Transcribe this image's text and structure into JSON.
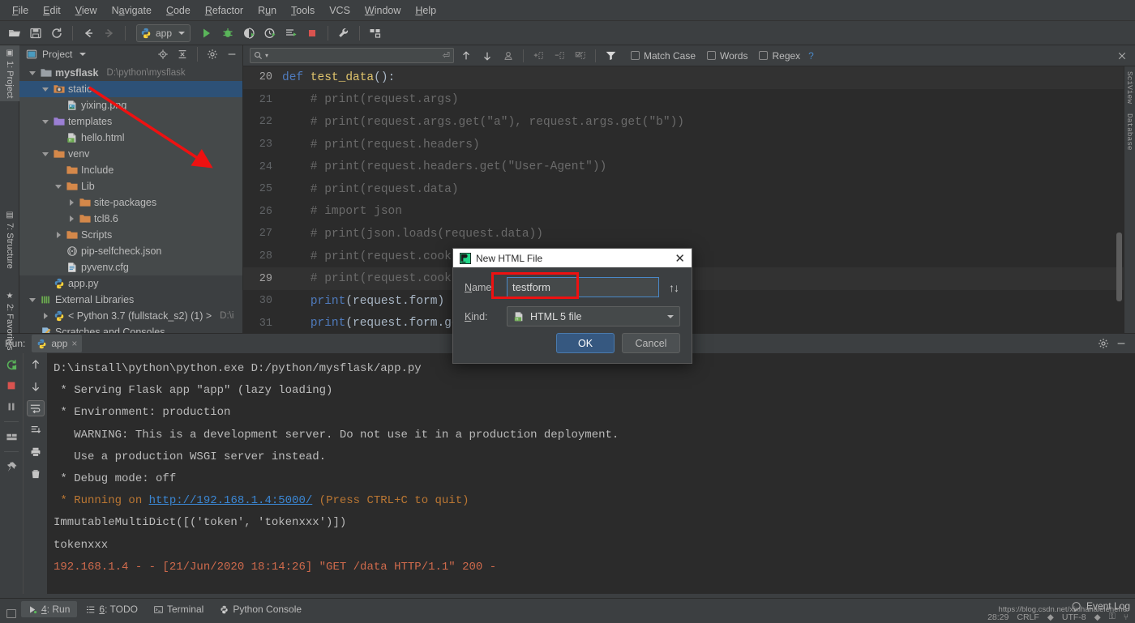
{
  "menubar": {
    "items": [
      "File",
      "Edit",
      "View",
      "Navigate",
      "Code",
      "Refactor",
      "Run",
      "Tools",
      "VCS",
      "Window",
      "Help"
    ]
  },
  "toolbar": {
    "run_config": "app",
    "icons": [
      "open-folder-icon",
      "save-icon",
      "sync-icon",
      "back-arrow-icon",
      "forward-arrow-icon",
      "run-icon",
      "debug-icon",
      "coverage-icon",
      "profile-icon",
      "run-with-console-icon",
      "stop-icon",
      "settings-wrench-icon",
      "structure-icon"
    ]
  },
  "left_strip": {
    "tabs": [
      {
        "label": "1: Project",
        "selected": true
      },
      {
        "label": "7: Structure",
        "selected": false
      },
      {
        "label": "2: Favorites",
        "selected": false
      }
    ]
  },
  "project_panel": {
    "title": "Project",
    "header_icons": [
      "locate-icon",
      "collapse-all-icon",
      "gear-icon",
      "minimize-icon"
    ],
    "tree": [
      {
        "label": "mysflask",
        "path": "D:\\python\\mysflask",
        "depth": 0,
        "twisty": "open",
        "icon": "folder-grey",
        "bold": true,
        "state": "normal"
      },
      {
        "label": "static",
        "path": "",
        "depth": 1,
        "twisty": "open",
        "icon": "folder-static",
        "bold": false,
        "state": "selected"
      },
      {
        "label": "yixing.png",
        "path": "",
        "depth": 2,
        "twisty": "none",
        "icon": "image-file",
        "bold": false,
        "state": "highlight"
      },
      {
        "label": "templates",
        "path": "",
        "depth": 1,
        "twisty": "open",
        "icon": "folder-purple",
        "bold": false,
        "state": "highlight"
      },
      {
        "label": "hello.html",
        "path": "",
        "depth": 2,
        "twisty": "none",
        "icon": "html-file",
        "bold": false,
        "state": "highlight"
      },
      {
        "label": "venv",
        "path": "",
        "depth": 1,
        "twisty": "open",
        "icon": "folder-orange",
        "bold": false,
        "state": "highlight"
      },
      {
        "label": "Include",
        "path": "",
        "depth": 2,
        "twisty": "none",
        "icon": "folder-orange",
        "bold": false,
        "state": "highlight"
      },
      {
        "label": "Lib",
        "path": "",
        "depth": 2,
        "twisty": "open",
        "icon": "folder-orange",
        "bold": false,
        "state": "highlight"
      },
      {
        "label": "site-packages",
        "path": "",
        "depth": 3,
        "twisty": "closed",
        "icon": "folder-orange",
        "bold": false,
        "state": "highlight"
      },
      {
        "label": "tcl8.6",
        "path": "",
        "depth": 3,
        "twisty": "closed",
        "icon": "folder-orange",
        "bold": false,
        "state": "highlight"
      },
      {
        "label": "Scripts",
        "path": "",
        "depth": 2,
        "twisty": "closed",
        "icon": "folder-orange",
        "bold": false,
        "state": "highlight"
      },
      {
        "label": "pip-selfcheck.json",
        "path": "",
        "depth": 2,
        "twisty": "none",
        "icon": "json-file",
        "bold": false,
        "state": "highlight"
      },
      {
        "label": "pyvenv.cfg",
        "path": "",
        "depth": 2,
        "twisty": "none",
        "icon": "cfg-file",
        "bold": false,
        "state": "highlight"
      },
      {
        "label": "app.py",
        "path": "",
        "depth": 1,
        "twisty": "none",
        "icon": "py-file",
        "bold": false,
        "state": "normal"
      },
      {
        "label": "External Libraries",
        "path": "",
        "depth": 0,
        "twisty": "open",
        "icon": "library-icon",
        "bold": false,
        "state": "normal"
      },
      {
        "label": "< Python 3.7 (fullstack_s2) (1) >",
        "path": "D:\\i",
        "depth": 1,
        "twisty": "closed",
        "icon": "py-file",
        "bold": false,
        "state": "normal"
      },
      {
        "label": "Scratches and Consoles",
        "path": "",
        "depth": 0,
        "twisty": "none",
        "icon": "scratch-icon",
        "bold": false,
        "state": "normal"
      }
    ]
  },
  "find_bar": {
    "search_value": "",
    "search_placeholder": "",
    "match_case": "Match Case",
    "words": "Words",
    "regex": "Regex",
    "help": "?",
    "icons": [
      "search-icon",
      "prev-occurrence-icon",
      "next-occurrence-icon",
      "select-all-occurrences-icon",
      "add-line-icon",
      "remove-line-icon",
      "check-lines-icon",
      "filter-icon",
      "close-icon"
    ]
  },
  "editor": {
    "lines": [
      {
        "no": "20",
        "current": true,
        "tokens": [
          {
            "t": "def ",
            "c": "kw"
          },
          {
            "t": "test_data",
            "c": "fn"
          },
          {
            "t": "():",
            "c": "pl"
          }
        ],
        "indent": 0
      },
      {
        "no": "21",
        "current": false,
        "tokens": [
          {
            "t": "    # print(request.args)",
            "c": "cm"
          }
        ],
        "indent": 0
      },
      {
        "no": "22",
        "current": false,
        "tokens": [
          {
            "t": "    # print(request.args.get(\"a\"), request.args.get(\"b\"))",
            "c": "cm"
          }
        ],
        "indent": 0
      },
      {
        "no": "23",
        "current": false,
        "tokens": [
          {
            "t": "    # print(request.headers)",
            "c": "cm"
          }
        ],
        "indent": 0
      },
      {
        "no": "24",
        "current": false,
        "tokens": [
          {
            "t": "    # print(request.headers.get(\"User-Agent\"))",
            "c": "cm"
          }
        ],
        "indent": 0
      },
      {
        "no": "25",
        "current": false,
        "tokens": [
          {
            "t": "    # print(request.data)",
            "c": "cm"
          }
        ],
        "indent": 0
      },
      {
        "no": "26",
        "current": false,
        "tokens": [
          {
            "t": "    # import json",
            "c": "cm"
          }
        ],
        "indent": 0
      },
      {
        "no": "27",
        "current": false,
        "tokens": [
          {
            "t": "    # print(json.loads(request.data))",
            "c": "cm"
          }
        ],
        "indent": 0
      },
      {
        "no": "28",
        "current": false,
        "tokens": [
          {
            "t": "    # print(request.cookies)",
            "c": "cm"
          }
        ],
        "indent": 0
      },
      {
        "no": "29",
        "current": true,
        "tokens": [
          {
            "t": "    # print(request.cookies.get(\"name\"))",
            "c": "cm"
          }
        ],
        "indent": 0
      },
      {
        "no": "30",
        "current": false,
        "tokens": [
          {
            "t": "    ",
            "c": "pl"
          },
          {
            "t": "print",
            "c": "kw"
          },
          {
            "t": "(request.form)",
            "c": "pl"
          }
        ],
        "indent": 0
      },
      {
        "no": "31",
        "current": false,
        "tokens": [
          {
            "t": "    ",
            "c": "pl"
          },
          {
            "t": "print",
            "c": "kw"
          },
          {
            "t": "(request.form.get(\"password\"))",
            "c": "pl"
          }
        ],
        "indent": 0
      }
    ]
  },
  "right_strip": {
    "tabs": [
      "SciView",
      "Database"
    ]
  },
  "run_panel": {
    "label": "Run:",
    "tab_name": "app",
    "close_glyph": "×",
    "left_tools": [
      "rerun-icon",
      "stop-icon",
      "pause-icon",
      "layout-icon",
      "pin-icon"
    ],
    "right_tools": [
      "up-arrow-icon",
      "down-arrow-icon",
      "soft-wrap-icon",
      "scroll-to-end-icon",
      "print-icon",
      "trash-icon"
    ],
    "console": [
      {
        "segments": [
          {
            "t": "D:\\install\\python\\python.exe D:/python/mysflask/app.py",
            "c": "plain"
          }
        ]
      },
      {
        "segments": [
          {
            "t": " * Serving Flask app \"app\" (lazy loading)",
            "c": "plain"
          }
        ]
      },
      {
        "segments": [
          {
            "t": " * Environment: production",
            "c": "plain"
          }
        ]
      },
      {
        "segments": [
          {
            "t": "   WARNING: This is a development server. Do not use it in a production deployment.",
            "c": "plain"
          }
        ]
      },
      {
        "segments": [
          {
            "t": "   Use a production WSGI server instead.",
            "c": "plain"
          }
        ]
      },
      {
        "segments": [
          {
            "t": " * Debug mode: off",
            "c": "plain"
          }
        ]
      },
      {
        "segments": [
          {
            "t": " * Running on ",
            "c": "orange"
          },
          {
            "t": "http://192.168.1.4:5000/",
            "c": "link"
          },
          {
            "t": " (Press CTRL+C to quit)",
            "c": "orange"
          }
        ]
      },
      {
        "segments": [
          {
            "t": "ImmutableMultiDict([('token', 'tokenxxx')])",
            "c": "plain"
          }
        ]
      },
      {
        "segments": [
          {
            "t": "tokenxxx",
            "c": "plain"
          }
        ]
      },
      {
        "segments": [
          {
            "t": "192.168.1.4 - - [21/Jun/2020 18:14:26] \"GET /data HTTP/1.1\" 200 -",
            "c": "red"
          }
        ]
      }
    ]
  },
  "dialog": {
    "title": "New HTML File",
    "title_icon": "pycharm-icon",
    "close_glyph": "✕",
    "name_label": "Name",
    "name_value": "testform",
    "updown_glyph": "↑↓",
    "kind_label": "Kind:",
    "kind_value": "HTML 5 file",
    "kind_icon": "html5-file-icon",
    "ok_label": "OK",
    "cancel_label": "Cancel"
  },
  "status_bar": {
    "tabs": [
      {
        "label": "4: Run",
        "icon": "run-icon",
        "selected": true
      },
      {
        "label": "6: TODO",
        "icon": "todo-icon",
        "selected": false
      },
      {
        "label": "Terminal",
        "icon": "terminal-icon",
        "selected": false
      },
      {
        "label": "Python Console",
        "icon": "python-icon",
        "selected": false
      }
    ],
    "event_log": "Event Log",
    "event_log_icon": "balloon-icon",
    "position": "28:29",
    "line_sep": "CRLF",
    "encoding": "UTF-8",
    "watermark": "https://blog.csdn.net/xixihahalelehehe"
  },
  "colors": {
    "bg": "#3c3f41",
    "editor_bg": "#2b2b2b",
    "selection": "#2d5177",
    "accent": "#365880",
    "annotation_red": "#ee1111",
    "folder_orange": "#d4884a",
    "folder_purple": "#9b7fd4",
    "link_blue": "#3b87d4"
  }
}
